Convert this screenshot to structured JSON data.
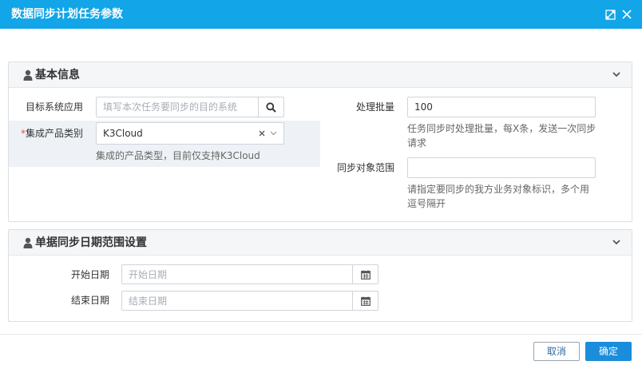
{
  "window": {
    "title": "数据同步计划任务参数"
  },
  "section_basic": {
    "title": "基本信息",
    "target_app": {
      "label": "目标系统应用",
      "placeholder": "填写本次任务要同步的目的系统"
    },
    "product_category": {
      "required_mark": "*",
      "label": "集成产品类别",
      "value": "K3Cloud",
      "help": "集成的产品类型，目前仅支持K3Cloud"
    },
    "batch_size": {
      "label": "处理批量",
      "value": "100",
      "help_line1": "任务同步时处理批量，每X条，发送一次同步",
      "help_line2": "请求"
    },
    "sync_scope": {
      "label": "同步对象范围",
      "value": "",
      "help_line1": "请指定要同步的我方业务对象标识，多个用",
      "help_line2": "逗号隔开"
    }
  },
  "section_date": {
    "title": "单据同步日期范围设置",
    "start_date": {
      "label": "开始日期",
      "placeholder": "开始日期"
    },
    "end_date": {
      "label": "结束日期",
      "placeholder": "结束日期"
    }
  },
  "footer": {
    "cancel_label": "取消",
    "ok_label": "确定"
  },
  "colors": {
    "titlebar": "#12a5e8",
    "primary_button": "#1a8ddc",
    "required": "#e54d42"
  }
}
